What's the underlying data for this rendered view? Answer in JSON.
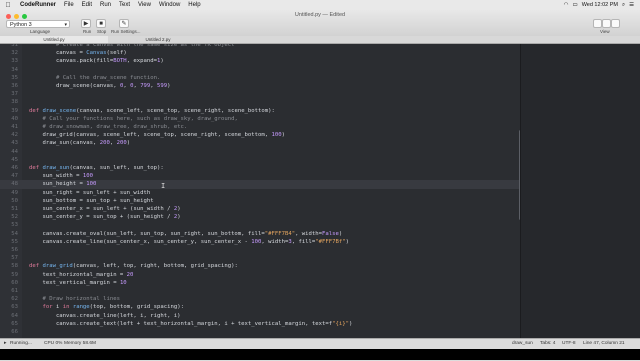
{
  "menubar": {
    "app": "CodeRunner",
    "items": [
      "File",
      "Edit",
      "Run",
      "Text",
      "View",
      "Window",
      "Help"
    ],
    "clock": "Wed 12:02 PM"
  },
  "window": {
    "title": "Untitled.py — Edited",
    "language": "Python 3",
    "language_label": "Language",
    "run_label": "Run",
    "stop_label": "Stop",
    "run_settings_label": "Run Settings...",
    "view_label": "View"
  },
  "tabs": [
    "Untitled.py",
    "Untitled 2.py"
  ],
  "editor": {
    "lines": [
      {
        "n": "31",
        "segs": [
          [
            "        ",
            "t"
          ],
          [
            "# Create a Canvas with the same size as the TK object",
            "com"
          ]
        ]
      },
      {
        "n": "32",
        "segs": [
          [
            "        canvas = ",
            "t"
          ],
          [
            "Canvas",
            "fn"
          ],
          [
            "(self)",
            "t"
          ]
        ]
      },
      {
        "n": "33",
        "segs": [
          [
            "        canvas.pack(fill=",
            "t"
          ],
          [
            "BOTH",
            "cnst"
          ],
          [
            ", expand=",
            "t"
          ],
          [
            "1",
            "num"
          ],
          [
            ")",
            "t"
          ]
        ]
      },
      {
        "n": "34",
        "segs": [
          [
            "",
            "t"
          ]
        ]
      },
      {
        "n": "35",
        "segs": [
          [
            "        ",
            "t"
          ],
          [
            "# Call the draw_scene function.",
            "com"
          ]
        ]
      },
      {
        "n": "36",
        "segs": [
          [
            "        draw_scene(canvas, ",
            "t"
          ],
          [
            "0",
            "num"
          ],
          [
            ", ",
            "t"
          ],
          [
            "0",
            "num"
          ],
          [
            ", ",
            "t"
          ],
          [
            "799",
            "num"
          ],
          [
            ", ",
            "t"
          ],
          [
            "599",
            "num"
          ],
          [
            ")",
            "t"
          ]
        ]
      },
      {
        "n": "37",
        "segs": [
          [
            "",
            "t"
          ]
        ]
      },
      {
        "n": "38",
        "segs": [
          [
            "",
            "t"
          ]
        ]
      },
      {
        "n": "39",
        "segs": [
          [
            "def ",
            "key"
          ],
          [
            "draw_scene",
            "fn"
          ],
          [
            "(canvas, scene_left, scene_top, scene_right, scene_bottom):",
            "t"
          ]
        ]
      },
      {
        "n": "40",
        "segs": [
          [
            "    ",
            "t"
          ],
          [
            "# Call your functions here, such as draw_sky, draw_ground,",
            "com"
          ]
        ]
      },
      {
        "n": "41",
        "segs": [
          [
            "    ",
            "t"
          ],
          [
            "# draw_snowman, draw_tree, draw_shrub, etc.",
            "com"
          ]
        ]
      },
      {
        "n": "42",
        "segs": [
          [
            "    draw_grid(canvas, scene_left, scene_top, scene_right, scene_bottom, ",
            "t"
          ],
          [
            "100",
            "num"
          ],
          [
            ")",
            "t"
          ]
        ]
      },
      {
        "n": "43",
        "segs": [
          [
            "    draw_sun(canvas, ",
            "t"
          ],
          [
            "200",
            "num"
          ],
          [
            ", ",
            "t"
          ],
          [
            "200",
            "num"
          ],
          [
            ")",
            "t"
          ]
        ]
      },
      {
        "n": "44",
        "segs": [
          [
            "",
            "t"
          ]
        ]
      },
      {
        "n": "45",
        "segs": [
          [
            "",
            "t"
          ]
        ]
      },
      {
        "n": "46",
        "segs": [
          [
            "def ",
            "key"
          ],
          [
            "draw_sun",
            "fn"
          ],
          [
            "(canvas, sun_left, sun_top):",
            "t"
          ]
        ]
      },
      {
        "n": "47",
        "segs": [
          [
            "    sun_width = ",
            "t"
          ],
          [
            "100",
            "num"
          ]
        ]
      },
      {
        "n": "48",
        "segs": [
          [
            "    sun_height = ",
            "t"
          ],
          [
            "100",
            "num"
          ]
        ]
      },
      {
        "n": "49",
        "segs": [
          [
            "    sun_right = sun_left + sun_width",
            "t"
          ]
        ]
      },
      {
        "n": "50",
        "segs": [
          [
            "    sun_bottom = sun_top + sun_height",
            "t"
          ]
        ]
      },
      {
        "n": "51",
        "segs": [
          [
            "    sun_center_x = sun_left + (sun_width / ",
            "t"
          ],
          [
            "2",
            "num"
          ],
          [
            ")",
            "t"
          ]
        ]
      },
      {
        "n": "52",
        "segs": [
          [
            "    sun_center_y = sun_top + (sun_height / ",
            "t"
          ],
          [
            "2",
            "num"
          ],
          [
            ")",
            "t"
          ]
        ]
      },
      {
        "n": "53",
        "segs": [
          [
            "",
            "t"
          ]
        ]
      },
      {
        "n": "54",
        "segs": [
          [
            "    canvas.create_oval(sun_left, sun_top, sun_right, sun_bottom, fill=",
            "t"
          ],
          [
            "\"#FFF7B4\"",
            "str"
          ],
          [
            ", width=",
            "t"
          ],
          [
            "False",
            "cnst"
          ],
          [
            ")",
            "t"
          ]
        ]
      },
      {
        "n": "55",
        "segs": [
          [
            "    canvas.create_line(sun_center_x, sun_center_y, sun_center_x - ",
            "t"
          ],
          [
            "100",
            "num"
          ],
          [
            ", width=",
            "t"
          ],
          [
            "3",
            "num"
          ],
          [
            ", fill=",
            "t"
          ],
          [
            "\"#FFF7Bf\"",
            "str"
          ],
          [
            ")",
            "t"
          ]
        ]
      },
      {
        "n": "56",
        "segs": [
          [
            "",
            "t"
          ]
        ]
      },
      {
        "n": "57",
        "segs": [
          [
            "",
            "t"
          ]
        ]
      },
      {
        "n": "58",
        "segs": [
          [
            "def ",
            "key"
          ],
          [
            "draw_grid",
            "fn"
          ],
          [
            "(canvas, left, top, right, bottom, grid_spacing):",
            "t"
          ]
        ]
      },
      {
        "n": "59",
        "segs": [
          [
            "    text_horizontal_margin = ",
            "t"
          ],
          [
            "20",
            "num"
          ]
        ]
      },
      {
        "n": "60",
        "segs": [
          [
            "    text_vertical_margin = ",
            "t"
          ],
          [
            "10",
            "num"
          ]
        ]
      },
      {
        "n": "61",
        "segs": [
          [
            "",
            "t"
          ]
        ]
      },
      {
        "n": "62",
        "segs": [
          [
            "    ",
            "t"
          ],
          [
            "# Draw horizontal lines",
            "com"
          ]
        ]
      },
      {
        "n": "63",
        "segs": [
          [
            "    ",
            "t"
          ],
          [
            "for ",
            "key"
          ],
          [
            "i ",
            "t"
          ],
          [
            "in ",
            "key"
          ],
          [
            "range",
            "fn"
          ],
          [
            "(top, bottom, grid_spacing):",
            "t"
          ]
        ]
      },
      {
        "n": "64",
        "segs": [
          [
            "        canvas.create_line(left, i, right, i)",
            "t"
          ]
        ]
      },
      {
        "n": "65",
        "segs": [
          [
            "        canvas.create_text(left + text_horizontal_margin, i + text_vertical_margin, text=f",
            "t"
          ],
          [
            "\"{i}\"",
            "str"
          ],
          [
            ")",
            "t"
          ]
        ]
      },
      {
        "n": "66",
        "segs": [
          [
            "",
            "t"
          ]
        ]
      }
    ]
  },
  "status": {
    "running": "Running...",
    "cpu": "CPU 0%",
    "memory": "Memory 58.6M",
    "file": "draw_sun",
    "tabs": "Tabs: 4",
    "encoding": "UTF-8",
    "position": "Line 47, Column 21"
  }
}
